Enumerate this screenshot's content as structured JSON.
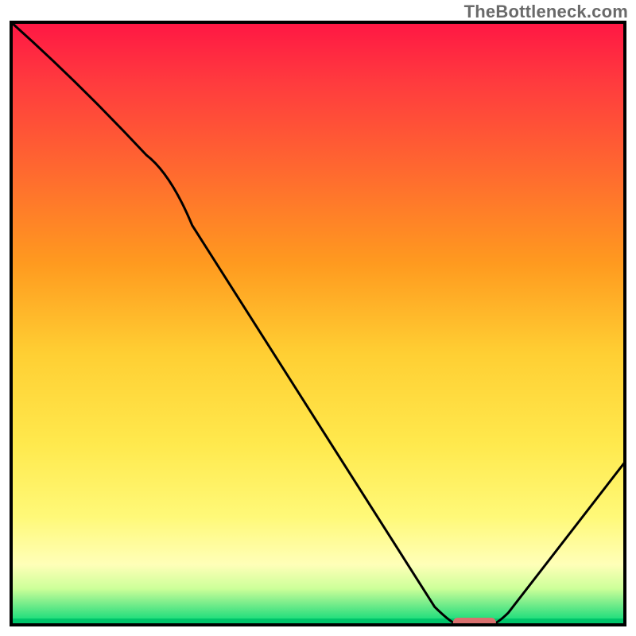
{
  "attribution": "TheBottleneck.com",
  "chart_data": {
    "type": "line",
    "title": "",
    "xlabel": "",
    "ylabel": "",
    "xlim": [
      0,
      100
    ],
    "ylim": [
      0,
      100
    ],
    "x": [
      0,
      22,
      72,
      79,
      100
    ],
    "values": [
      100,
      78,
      0,
      0,
      27
    ],
    "marker": {
      "x_start": 72,
      "x_end": 79,
      "y": 0,
      "color": "#d9706e"
    },
    "background_gradient": {
      "stops": [
        {
          "pos": 0.0,
          "color": "#ff1744"
        },
        {
          "pos": 0.1,
          "color": "#ff3b3e"
        },
        {
          "pos": 0.25,
          "color": "#ff6a2f"
        },
        {
          "pos": 0.4,
          "color": "#ff9a1f"
        },
        {
          "pos": 0.55,
          "color": "#ffcf33"
        },
        {
          "pos": 0.7,
          "color": "#ffe94d"
        },
        {
          "pos": 0.82,
          "color": "#fff978"
        },
        {
          "pos": 0.9,
          "color": "#ffffb8"
        },
        {
          "pos": 0.94,
          "color": "#ccff99"
        },
        {
          "pos": 0.97,
          "color": "#66e988"
        },
        {
          "pos": 1.0,
          "color": "#00d977"
        }
      ]
    },
    "frame_color": "#000000",
    "curve_color": "#000000"
  }
}
